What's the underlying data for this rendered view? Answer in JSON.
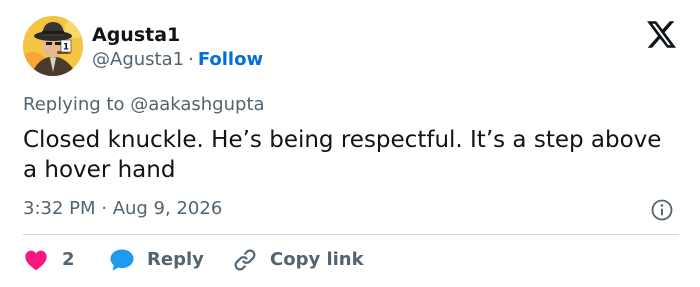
{
  "author": {
    "display_name": "Agusta1",
    "handle": "@Agusta1",
    "separator": "·",
    "follow_label": "Follow"
  },
  "tweet": {
    "replying_to": "Replying to @aakashgupta",
    "text": "Closed knuckle. He’s being respectful. It’s a step above a hover hand",
    "timestamp": "3:32 PM · Aug 9, 2026"
  },
  "actions": {
    "like_count": "2",
    "reply_label": "Reply",
    "copy_label": "Copy link"
  },
  "icons": {
    "logo": "x-logo-icon",
    "info": "info-icon",
    "like": "heart-icon",
    "reply": "speech-bubble-icon",
    "copy": "link-icon"
  },
  "colors": {
    "heart": "#f91880",
    "reply_bubble": "#1d9bf0",
    "follow": "#006fd6",
    "secondary_text": "#536471",
    "primary_text": "#0f1419",
    "divider": "#cfd9de"
  }
}
